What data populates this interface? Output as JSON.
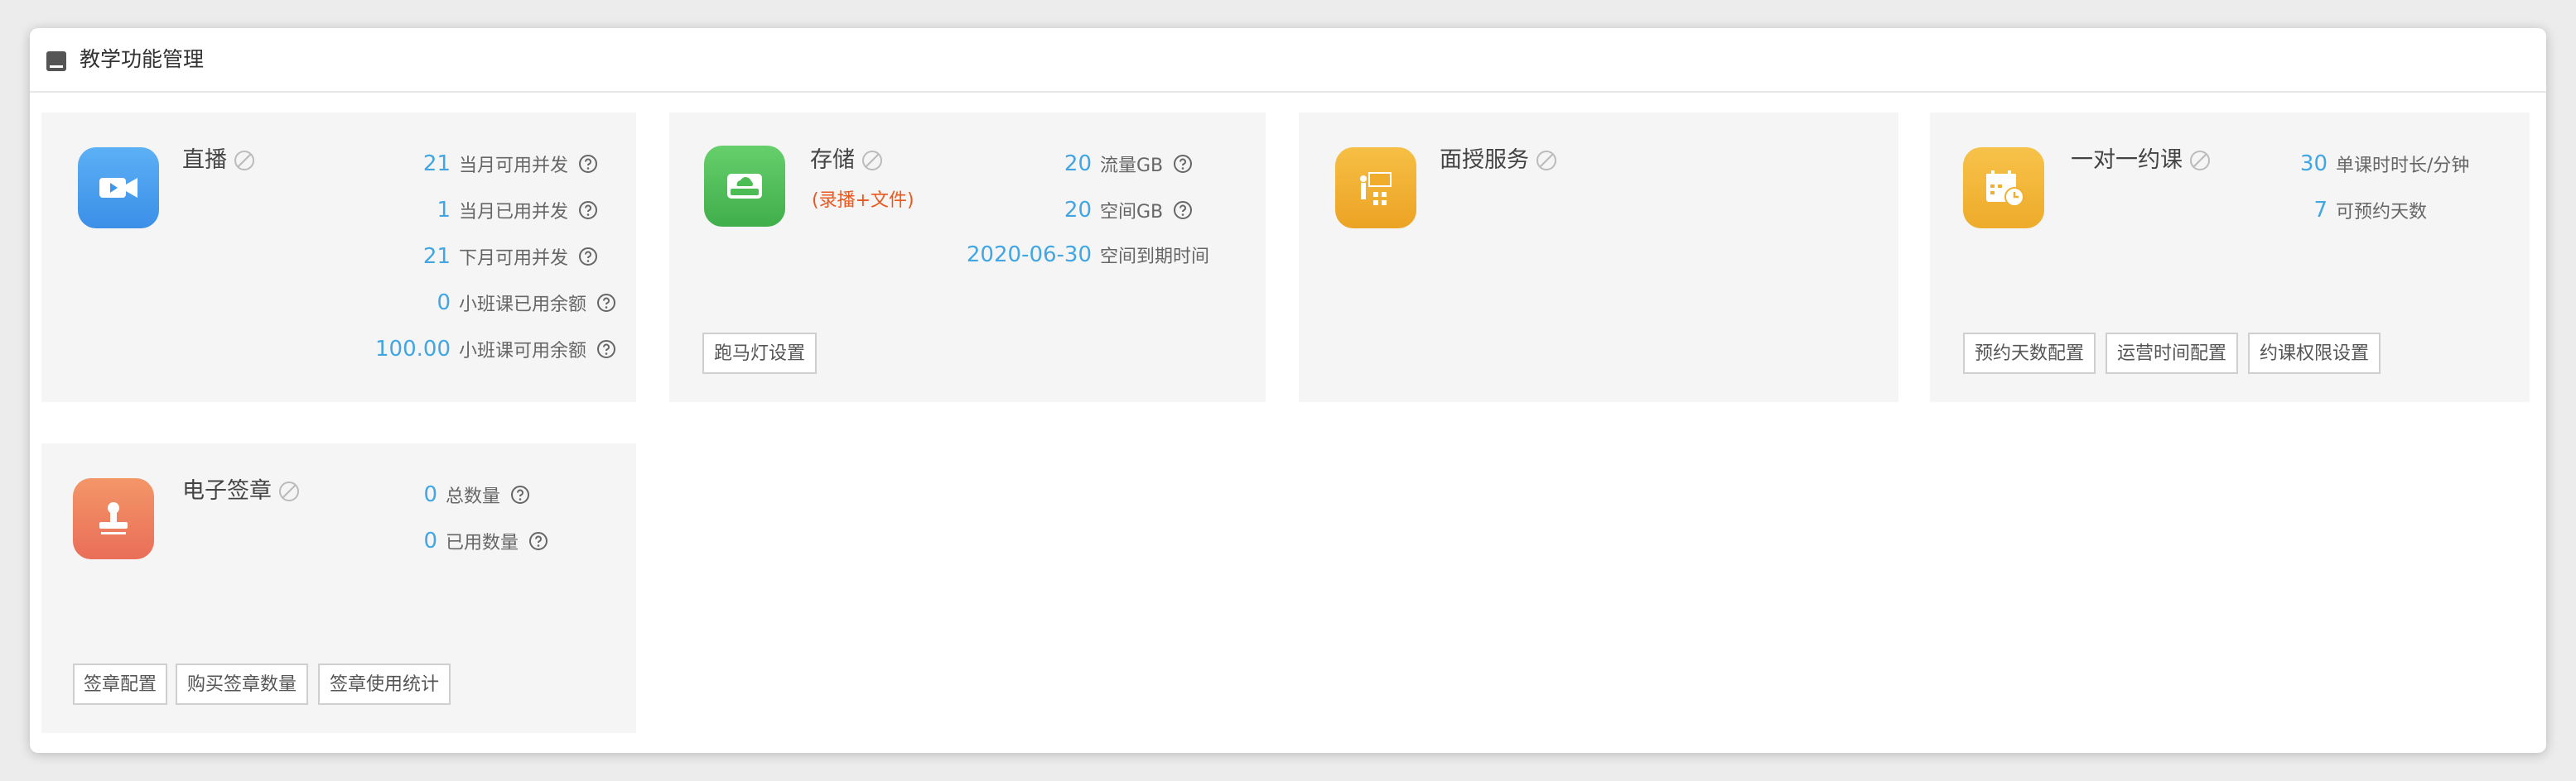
{
  "header": {
    "title": "教学功能管理"
  },
  "cards": {
    "live": {
      "title": "直播",
      "stats": [
        {
          "value": "21",
          "label": "当月可用并发"
        },
        {
          "value": "1",
          "label": "当月已用并发"
        },
        {
          "value": "21",
          "label": "下月可用并发"
        },
        {
          "value": "0",
          "label": "小班课已用余额"
        },
        {
          "value": "100.00",
          "label": "小班课可用余额"
        }
      ]
    },
    "storage": {
      "title": "存储",
      "subtitle": "(录播+文件)",
      "stats": [
        {
          "value": "20",
          "label": "流量GB"
        },
        {
          "value": "20",
          "label": "空间GB"
        },
        {
          "value": "2020-06-30",
          "label": "空间到期时间"
        }
      ],
      "buttons": [
        "跑马灯设置"
      ]
    },
    "tutoring": {
      "title": "面授服务"
    },
    "one_on_one": {
      "title": "一对一约课",
      "stats": [
        {
          "value": "30",
          "label": "单课时时长/分钟"
        },
        {
          "value": "7",
          "label": "可预约天数"
        }
      ],
      "buttons": [
        "预约天数配置",
        "运营时间配置",
        "约课权限设置"
      ]
    },
    "esign": {
      "title": "电子签章",
      "stats": [
        {
          "value": "0",
          "label": "总数量"
        },
        {
          "value": "0",
          "label": "已用数量"
        }
      ],
      "buttons": [
        "签章配置",
        "购买签章数量",
        "签章使用统计"
      ]
    }
  },
  "colors": {
    "accent": "#41a6e2",
    "live_icon": "#4a9ff0",
    "storage_icon": "#52c45a",
    "tutoring_icon": "#f2b032",
    "one_on_one_icon": "#f4b83c",
    "esign_icon": "#f07a5c",
    "subtitle": "#e8581f"
  },
  "icons": {
    "header": "book-icon",
    "live": "video-camera-icon",
    "storage": "cloud-drive-icon",
    "tutoring": "classroom-icon",
    "one_on_one": "calendar-clock-icon",
    "esign": "stamp-icon",
    "status": "disabled-icon",
    "help": "question-circle-icon"
  }
}
